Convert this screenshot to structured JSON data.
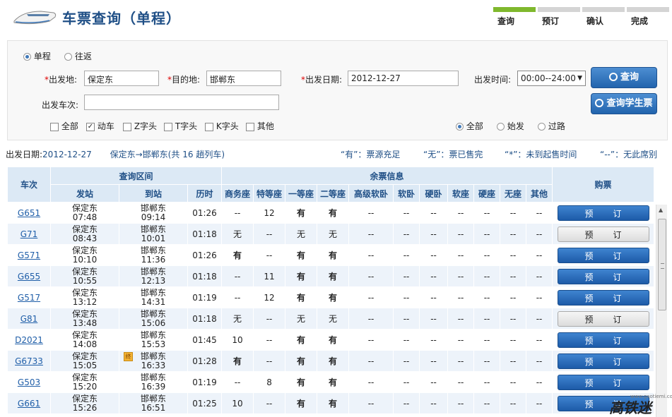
{
  "header": {
    "title": "车票查询（单程）",
    "steps": [
      {
        "label": "查询",
        "active": true
      },
      {
        "label": "预订",
        "active": false
      },
      {
        "label": "确认",
        "active": false
      },
      {
        "label": "完成",
        "active": false
      }
    ]
  },
  "form": {
    "trip_type": {
      "options": [
        "单程",
        "往返"
      ],
      "selected": "单程"
    },
    "from_label": "出发地:",
    "from_value": "保定东",
    "to_label": "目的地:",
    "to_value": "邯郸东",
    "date_label": "出发日期:",
    "date_value": "2012-12-27",
    "time_label": "出发时间:",
    "time_value": "00:00--24:00",
    "train_no_label": "出发车次:",
    "train_no_value": "",
    "query_button": "查询",
    "student_button": "查询学生票",
    "train_types": [
      {
        "label": "全部",
        "checked": false
      },
      {
        "label": "动车",
        "checked": true
      },
      {
        "label": "Z字头",
        "checked": false
      },
      {
        "label": "T字头",
        "checked": false
      },
      {
        "label": "K字头",
        "checked": false
      },
      {
        "label": "其他",
        "checked": false
      }
    ],
    "stop_types": {
      "options": [
        "全部",
        "始发",
        "过路"
      ],
      "selected": "全部"
    }
  },
  "summary": {
    "date_label": "出发日期:",
    "date_value": "2012-12-27",
    "route": "保定东→邯郸东(共",
    "count": "16",
    "count_suffix": "趟列车)",
    "legend": [
      "“有”：票源充足",
      "“无”：票已售完",
      "“*”：未到起售时间",
      "“--”：无此席别"
    ]
  },
  "table": {
    "head_train": "车次",
    "head_section": "查询区间",
    "head_seats": "余票信息",
    "head_buy": "购票",
    "head_depart": "发站",
    "head_arrive": "到站",
    "head_duration": "历时",
    "seat_headers": [
      "商务座",
      "特等座",
      "一等座",
      "二等座",
      "高级软卧",
      "软卧",
      "硬卧",
      "软座",
      "硬座",
      "无座",
      "其他"
    ],
    "book_label": "预订",
    "start_badge": "终",
    "rows": [
      {
        "code": "G651",
        "from": "保定东",
        "dep": "07:48",
        "to": "邯郸东",
        "arr": "09:14",
        "dur": "01:26",
        "seats": [
          "--",
          "12",
          "有",
          "有",
          "--",
          "--",
          "--",
          "--",
          "--",
          "--",
          "--"
        ],
        "bookable": true,
        "badge": false
      },
      {
        "code": "G71",
        "from": "保定东",
        "dep": "08:43",
        "to": "邯郸东",
        "arr": "10:01",
        "dur": "01:18",
        "seats": [
          "无",
          "--",
          "无",
          "无",
          "--",
          "--",
          "--",
          "--",
          "--",
          "--",
          "--"
        ],
        "bookable": false,
        "badge": false
      },
      {
        "code": "G571",
        "from": "保定东",
        "dep": "10:10",
        "to": "邯郸东",
        "arr": "11:36",
        "dur": "01:26",
        "seats": [
          "有",
          "--",
          "有",
          "有",
          "--",
          "--",
          "--",
          "--",
          "--",
          "--",
          "--"
        ],
        "bookable": true,
        "badge": false
      },
      {
        "code": "G655",
        "from": "保定东",
        "dep": "10:55",
        "to": "邯郸东",
        "arr": "12:13",
        "dur": "01:18",
        "seats": [
          "--",
          "11",
          "有",
          "有",
          "--",
          "--",
          "--",
          "--",
          "--",
          "--",
          "--"
        ],
        "bookable": true,
        "badge": false
      },
      {
        "code": "G517",
        "from": "保定东",
        "dep": "13:12",
        "to": "邯郸东",
        "arr": "14:31",
        "dur": "01:19",
        "seats": [
          "--",
          "12",
          "有",
          "有",
          "--",
          "--",
          "--",
          "--",
          "--",
          "--",
          "--"
        ],
        "bookable": true,
        "badge": false
      },
      {
        "code": "G81",
        "from": "保定东",
        "dep": "13:48",
        "to": "邯郸东",
        "arr": "15:06",
        "dur": "01:18",
        "seats": [
          "无",
          "--",
          "无",
          "无",
          "--",
          "--",
          "--",
          "--",
          "--",
          "--",
          "--"
        ],
        "bookable": false,
        "badge": false
      },
      {
        "code": "D2021",
        "from": "保定东",
        "dep": "14:08",
        "to": "邯郸东",
        "arr": "15:53",
        "dur": "01:45",
        "seats": [
          "10",
          "--",
          "有",
          "有",
          "--",
          "--",
          "--",
          "--",
          "--",
          "--",
          "--"
        ],
        "bookable": true,
        "badge": false
      },
      {
        "code": "G6733",
        "from": "保定东",
        "dep": "15:05",
        "to": "邯郸东",
        "arr": "16:33",
        "dur": "01:28",
        "seats": [
          "有",
          "--",
          "有",
          "有",
          "--",
          "--",
          "--",
          "--",
          "--",
          "--",
          "--"
        ],
        "bookable": true,
        "badge": true
      },
      {
        "code": "G503",
        "from": "保定东",
        "dep": "15:20",
        "to": "邯郸东",
        "arr": "16:39",
        "dur": "01:19",
        "seats": [
          "--",
          "8",
          "有",
          "有",
          "--",
          "--",
          "--",
          "--",
          "--",
          "--",
          "--"
        ],
        "bookable": true,
        "badge": false
      },
      {
        "code": "G661",
        "from": "保定东",
        "dep": "15:26",
        "to": "邯郸东",
        "arr": "16:51",
        "dur": "01:25",
        "seats": [
          "10",
          "--",
          "有",
          "有",
          "--",
          "--",
          "--",
          "--",
          "--",
          "--",
          "--"
        ],
        "bookable": true,
        "badge": false
      }
    ]
  },
  "watermark": {
    "text": "高铁迷",
    "small": "www.gaotiemi.com"
  },
  "colors": {
    "accent": "#1f4f86",
    "available": "#0a8a1f",
    "step_active": "#7fb82d",
    "header_bg": "#dce9f5"
  }
}
